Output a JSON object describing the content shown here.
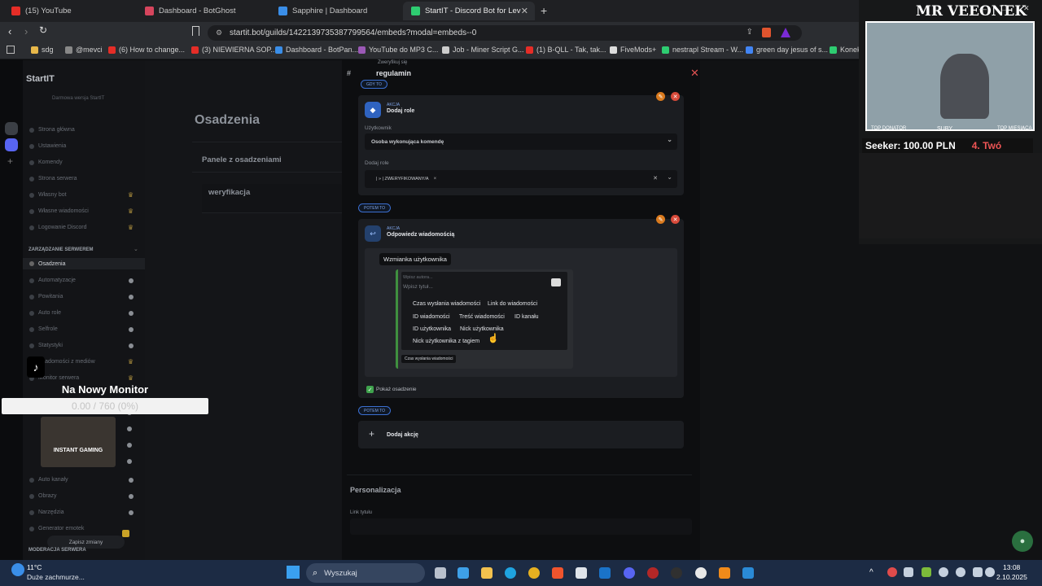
{
  "browser": {
    "tabs": [
      {
        "title": "(15) YouTube",
        "color": "#e52d27"
      },
      {
        "title": "Dashboard - BotGhost",
        "color": "#d6455d"
      },
      {
        "title": "Sapphire | Dashboard",
        "color": "#3a8ee8"
      },
      {
        "title": "StartIT - Discord Bot for Leveling",
        "color": "#2ecc71"
      }
    ],
    "url": "startit.bot/guilds/1422139735387799564/embeds?modal=embeds--0",
    "bookmarks": [
      "sdg",
      "@mevci",
      "(6) How to change...",
      "(3) NIEWIERNA SOP...",
      "Dashboard - BotPan...",
      "YouTube do MP3 C...",
      "Job - Miner Script G...",
      "(1) B-QLL - Tak, tak...",
      "FiveMods+",
      "nestrapl Stream - W...",
      "green day jesus of s...",
      "Konek"
    ]
  },
  "sidebar": {
    "logo": "StartIT",
    "subtitle": "Darmowa wersja StartIT",
    "items": [
      "Strona główna",
      "Ustawienia",
      "Komendy",
      "Strona serwera",
      "Własny bot",
      "Własne wiadomości",
      "Logowanie Discord"
    ],
    "section": "ZARZĄDZANIE SERWEREM",
    "items2": [
      "Osadzenia",
      "Automatyzacje",
      "Powitania",
      "Auto role",
      "Selfrole",
      "Statystyki",
      "Wiadomości z mediów",
      "Monitor serwera"
    ],
    "items3": [
      "Auto kanały",
      "Obrazy",
      "Narzędzia",
      "Generator emotek"
    ],
    "save": "Zapisz zmiany",
    "section2": "MODERACJA SERWERA"
  },
  "main": {
    "title": "Osadzenia",
    "panel_title": "Panele z osadzeniami",
    "panel_item": "weryfikacja"
  },
  "modal": {
    "breadcrumb_small": "Zweryfikuj się",
    "channel": "regulamin",
    "pill1": "GDY TO",
    "card1": {
      "small": "AKCJA",
      "title": "Dodaj role",
      "user_label": "Użytkownik",
      "user_value": "Osoba wykonująca komendę",
      "role_label": "Dodaj role",
      "role_value": "| » | ZWERYFIKOWANY/A"
    },
    "pill2": "POTEM TO",
    "card2": {
      "small": "AKCJA",
      "title": "Odpowiedz wiadomością"
    },
    "embed": {
      "tooltip": "Wzmianka użytkownika",
      "author_placeholder": "Wpisz autora...",
      "title_placeholder": "Wpisz tytuł...",
      "options": [
        "Czas wysłania wiadomości",
        "Link do wiadomości",
        "ID wiadomości",
        "Treść wiadomości",
        "ID kanału",
        "ID użytkownika",
        "Nick użytkownika",
        "Nick użytkownika z tagiem"
      ],
      "footer_chip": "Czas wysłania wiadomości"
    },
    "show_embed": "Pokaż osadzenie",
    "pill3": "POTEM TO",
    "add_action": "Dodaj akcję",
    "personalization": "Personalizacja",
    "link_label": "Link tytułu"
  },
  "overlay": {
    "monitor_title": "Na Nowy Monitor",
    "monitor_progress": "0.00 / 760 (0%)",
    "progress_fraction": 0,
    "ad_text": "INSTANT GAMING",
    "cam_name": "MR VEEONEK",
    "cam_top_donator": "TOP DONATOR",
    "cam_suby": "SUBY",
    "cam_top_miesiaca": "TOP MIESIĄCA",
    "cam_ticker": "Seeker: 100.00 PLN",
    "cam_ticker2": "4. Twó"
  },
  "taskbar": {
    "weather_temp": "11°C",
    "weather_desc": "Duże zachmurze...",
    "search": "Wyszukaj",
    "time": "13:08",
    "date": "2.10.2025"
  }
}
